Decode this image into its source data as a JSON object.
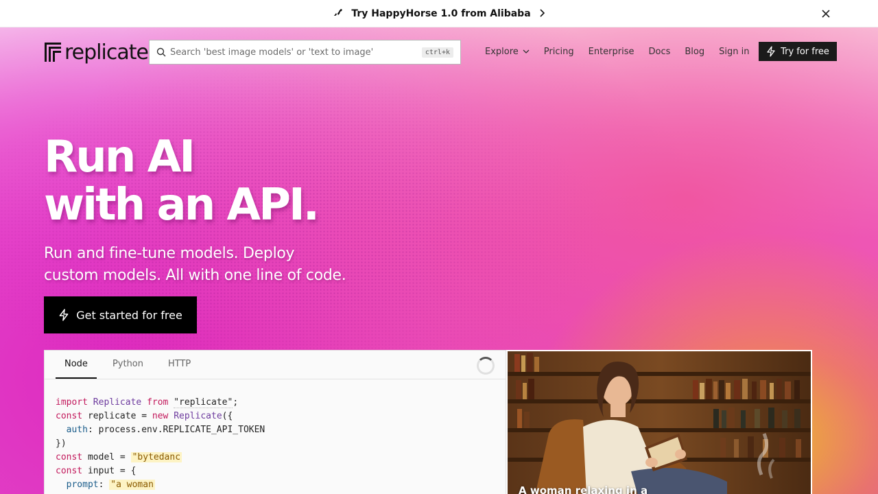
{
  "announcement": {
    "text": "Try HappyHorse 1.0 from Alibaba",
    "icon": "horse-icon",
    "close_icon": "close-icon"
  },
  "header": {
    "logo_text": "replicate",
    "search": {
      "placeholder": "Search 'best image models' or 'text to image'",
      "shortcut": "ctrl+k"
    },
    "nav": {
      "explore": "Explore",
      "pricing": "Pricing",
      "enterprise": "Enterprise",
      "docs": "Docs",
      "blog": "Blog",
      "sign_in": "Sign in"
    },
    "try_button": "Try for free"
  },
  "hero": {
    "headline_line1": "Run AI",
    "headline_line2": "with an API.",
    "subhead_line1": "Run and fine-tune models. Deploy",
    "subhead_line2": "custom models. All with one line of code.",
    "cta": "Get started for free"
  },
  "code_panel": {
    "tabs": [
      "Node",
      "Python",
      "HTTP"
    ],
    "active_tab": "Node",
    "lines": {
      "l1_kw": "import",
      "l1_cls": "Replicate",
      "l1_from": "from",
      "l1_str": "\"replicate\"",
      "l1_end": ";",
      "l2_kw": "const",
      "l2_mid": " replicate = ",
      "l2_new": "new",
      "l2_cls": "Replicate",
      "l2_end": "({",
      "l3_prop": "auth",
      "l3_rest": ": process.env.REPLICATE_API_TOKEN",
      "l4": "})",
      "l5_kw": "const",
      "l5_mid": " model = ",
      "l5_hl": "\"bytedanc",
      "l6_kw": "const",
      "l6_mid": " input = {",
      "l7_prop": "prompt",
      "l7_colon": ": ",
      "l7_hl": "\"a woman",
      "l8": "};"
    }
  },
  "image_panel": {
    "caption": "A woman relaxing in a"
  },
  "colors": {
    "accent_dark": "#1b1b1b",
    "gradient_pink": "#e23fcf",
    "gradient_gold": "#ecbe28"
  }
}
